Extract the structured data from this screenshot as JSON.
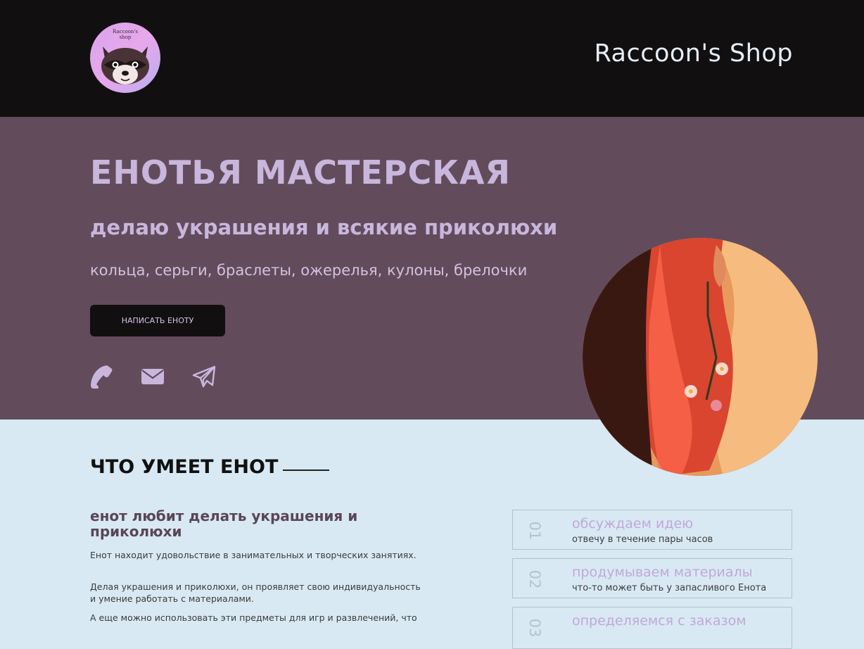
{
  "header": {
    "logo_text": "Raccoon's\nshop",
    "site_title": "Raccoon's Shop"
  },
  "hero": {
    "title": "ЕНОТЬЯ МАСТЕРСКАЯ",
    "subtitle": "делаю украшения и всякие приколюхи",
    "items": "кольца, серьги, браслеты, ожерелья, кулоны, брелочки",
    "cta_label": "НАПИСАТЬ ЕНОТУ",
    "social_icons": [
      "phone-icon",
      "mail-icon",
      "telegram-icon"
    ]
  },
  "skills": {
    "title": "ЧТО УМЕЕТ ЕНОТ",
    "heading": "енот любит делать украшения и приколюхи",
    "paragraphs": [
      "Енот находит удовольствие в занимательных и творческих занятиях.",
      "Делая украшения и приколюхи, он проявляет свою индивидуальность и умение работать с материалами.",
      "А еще можно использовать эти предметы для игр и развлечений, что"
    ]
  },
  "steps": [
    {
      "num": "01",
      "title": "обсуждаем идею",
      "desc": "отвечу в течение пары часов"
    },
    {
      "num": "02",
      "title": "продумываем материалы",
      "desc": "что-то может быть у запасливого Енота"
    },
    {
      "num": "03",
      "title": "определяемся с заказом",
      "desc": ""
    }
  ],
  "colors": {
    "header_bg": "#120f11",
    "hero_bg": "#624c5c",
    "accent": "#c9b6dc",
    "section_bg": "#d8e9f3"
  }
}
